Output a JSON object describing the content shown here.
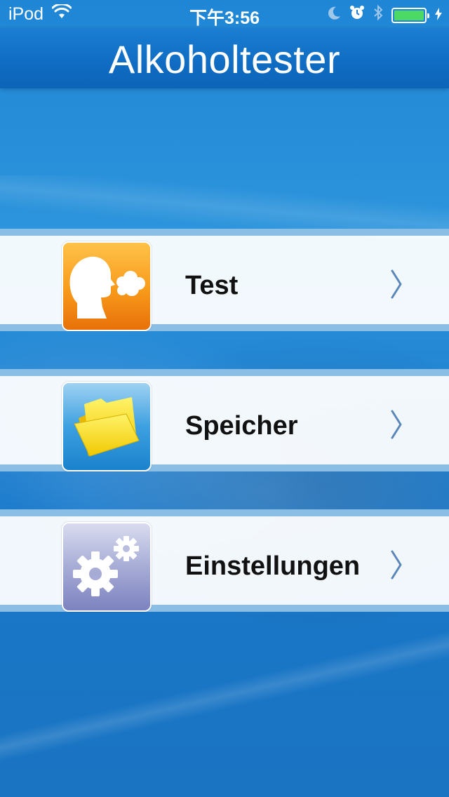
{
  "status_bar": {
    "carrier": "iPod",
    "time": "下午3:56",
    "icons": [
      "wifi-icon",
      "moon-icon",
      "alarm-icon",
      "bluetooth-icon",
      "battery-icon"
    ],
    "battery_level": 1.0,
    "battery_color": "#4cd964"
  },
  "nav": {
    "title": "Alkoholtester"
  },
  "menu": {
    "items": [
      {
        "label": "Test",
        "icon": "breath-test-icon"
      },
      {
        "label": "Speicher",
        "icon": "folder-icon"
      },
      {
        "label": "Einstellungen",
        "icon": "settings-gears-icon"
      }
    ]
  },
  "colors": {
    "background": "#1a78c8",
    "nav_bar": "#0f6cc2",
    "chevron": "#5a86b8"
  }
}
